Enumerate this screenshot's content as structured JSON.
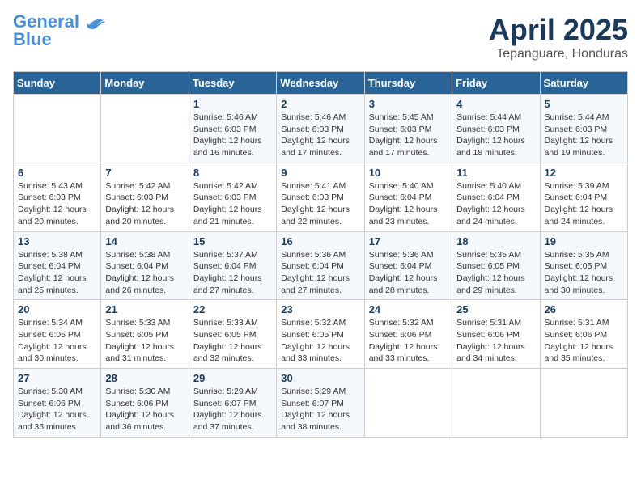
{
  "header": {
    "logo_line1": "General",
    "logo_line2": "Blue",
    "title": "April 2025",
    "subtitle": "Tepanguare, Honduras"
  },
  "days_of_week": [
    "Sunday",
    "Monday",
    "Tuesday",
    "Wednesday",
    "Thursday",
    "Friday",
    "Saturday"
  ],
  "weeks": [
    [
      {
        "num": "",
        "info": ""
      },
      {
        "num": "",
        "info": ""
      },
      {
        "num": "1",
        "info": "Sunrise: 5:46 AM\nSunset: 6:03 PM\nDaylight: 12 hours and 16 minutes."
      },
      {
        "num": "2",
        "info": "Sunrise: 5:46 AM\nSunset: 6:03 PM\nDaylight: 12 hours and 17 minutes."
      },
      {
        "num": "3",
        "info": "Sunrise: 5:45 AM\nSunset: 6:03 PM\nDaylight: 12 hours and 17 minutes."
      },
      {
        "num": "4",
        "info": "Sunrise: 5:44 AM\nSunset: 6:03 PM\nDaylight: 12 hours and 18 minutes."
      },
      {
        "num": "5",
        "info": "Sunrise: 5:44 AM\nSunset: 6:03 PM\nDaylight: 12 hours and 19 minutes."
      }
    ],
    [
      {
        "num": "6",
        "info": "Sunrise: 5:43 AM\nSunset: 6:03 PM\nDaylight: 12 hours and 20 minutes."
      },
      {
        "num": "7",
        "info": "Sunrise: 5:42 AM\nSunset: 6:03 PM\nDaylight: 12 hours and 20 minutes."
      },
      {
        "num": "8",
        "info": "Sunrise: 5:42 AM\nSunset: 6:03 PM\nDaylight: 12 hours and 21 minutes."
      },
      {
        "num": "9",
        "info": "Sunrise: 5:41 AM\nSunset: 6:03 PM\nDaylight: 12 hours and 22 minutes."
      },
      {
        "num": "10",
        "info": "Sunrise: 5:40 AM\nSunset: 6:04 PM\nDaylight: 12 hours and 23 minutes."
      },
      {
        "num": "11",
        "info": "Sunrise: 5:40 AM\nSunset: 6:04 PM\nDaylight: 12 hours and 24 minutes."
      },
      {
        "num": "12",
        "info": "Sunrise: 5:39 AM\nSunset: 6:04 PM\nDaylight: 12 hours and 24 minutes."
      }
    ],
    [
      {
        "num": "13",
        "info": "Sunrise: 5:38 AM\nSunset: 6:04 PM\nDaylight: 12 hours and 25 minutes."
      },
      {
        "num": "14",
        "info": "Sunrise: 5:38 AM\nSunset: 6:04 PM\nDaylight: 12 hours and 26 minutes."
      },
      {
        "num": "15",
        "info": "Sunrise: 5:37 AM\nSunset: 6:04 PM\nDaylight: 12 hours and 27 minutes."
      },
      {
        "num": "16",
        "info": "Sunrise: 5:36 AM\nSunset: 6:04 PM\nDaylight: 12 hours and 27 minutes."
      },
      {
        "num": "17",
        "info": "Sunrise: 5:36 AM\nSunset: 6:04 PM\nDaylight: 12 hours and 28 minutes."
      },
      {
        "num": "18",
        "info": "Sunrise: 5:35 AM\nSunset: 6:05 PM\nDaylight: 12 hours and 29 minutes."
      },
      {
        "num": "19",
        "info": "Sunrise: 5:35 AM\nSunset: 6:05 PM\nDaylight: 12 hours and 30 minutes."
      }
    ],
    [
      {
        "num": "20",
        "info": "Sunrise: 5:34 AM\nSunset: 6:05 PM\nDaylight: 12 hours and 30 minutes."
      },
      {
        "num": "21",
        "info": "Sunrise: 5:33 AM\nSunset: 6:05 PM\nDaylight: 12 hours and 31 minutes."
      },
      {
        "num": "22",
        "info": "Sunrise: 5:33 AM\nSunset: 6:05 PM\nDaylight: 12 hours and 32 minutes."
      },
      {
        "num": "23",
        "info": "Sunrise: 5:32 AM\nSunset: 6:05 PM\nDaylight: 12 hours and 33 minutes."
      },
      {
        "num": "24",
        "info": "Sunrise: 5:32 AM\nSunset: 6:06 PM\nDaylight: 12 hours and 33 minutes."
      },
      {
        "num": "25",
        "info": "Sunrise: 5:31 AM\nSunset: 6:06 PM\nDaylight: 12 hours and 34 minutes."
      },
      {
        "num": "26",
        "info": "Sunrise: 5:31 AM\nSunset: 6:06 PM\nDaylight: 12 hours and 35 minutes."
      }
    ],
    [
      {
        "num": "27",
        "info": "Sunrise: 5:30 AM\nSunset: 6:06 PM\nDaylight: 12 hours and 35 minutes."
      },
      {
        "num": "28",
        "info": "Sunrise: 5:30 AM\nSunset: 6:06 PM\nDaylight: 12 hours and 36 minutes."
      },
      {
        "num": "29",
        "info": "Sunrise: 5:29 AM\nSunset: 6:07 PM\nDaylight: 12 hours and 37 minutes."
      },
      {
        "num": "30",
        "info": "Sunrise: 5:29 AM\nSunset: 6:07 PM\nDaylight: 12 hours and 38 minutes."
      },
      {
        "num": "",
        "info": ""
      },
      {
        "num": "",
        "info": ""
      },
      {
        "num": "",
        "info": ""
      }
    ]
  ]
}
